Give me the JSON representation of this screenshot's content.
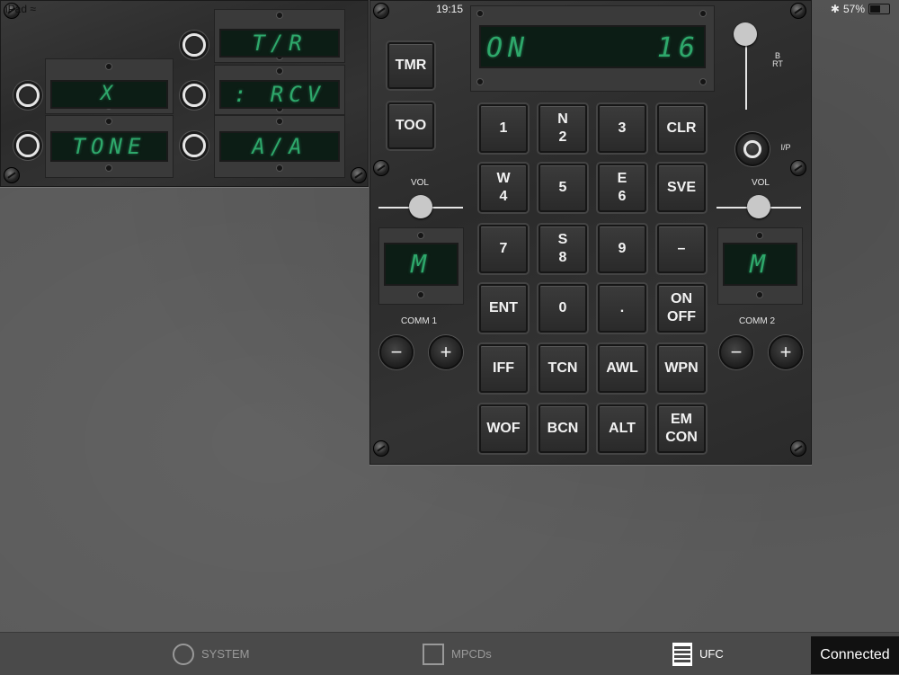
{
  "status_bar": {
    "device": "iPad",
    "time": "19:15",
    "battery_percent": "57%",
    "battery_level": 0.57
  },
  "left_panel": {
    "lcds": {
      "tr": "T/R",
      "x": "X",
      "rcv": ": RCV",
      "tone": "TONE",
      "aa": "A/A"
    }
  },
  "ufc": {
    "scratchpad_left": "ON",
    "scratchpad_right": "16",
    "tmr": "TMR",
    "too": "TOO",
    "brt": "BRT",
    "ip": "I/P",
    "vol_left": "VOL",
    "vol_right": "VOL",
    "vol_left_level": 0.5,
    "vol_right_level": 0.5,
    "brt_level": 0.85,
    "comm1_label": "COMM 1",
    "comm2_label": "COMM 2",
    "comm1_channel": "M",
    "comm2_channel": "M",
    "minus": "−",
    "plus": "+",
    "keys": {
      "k1": {
        "top": "",
        "bot": "1"
      },
      "k2": {
        "top": "N",
        "bot": "2"
      },
      "k3": {
        "top": "",
        "bot": "3"
      },
      "clr": {
        "top": "",
        "bot": "CLR"
      },
      "k4": {
        "top": "W",
        "bot": "4"
      },
      "k5": {
        "top": "",
        "bot": "5"
      },
      "k6": {
        "top": "E",
        "bot": "6"
      },
      "sve": {
        "top": "",
        "bot": "SVE"
      },
      "k7": {
        "top": "",
        "bot": "7"
      },
      "k8": {
        "top": "S",
        "bot": "8"
      },
      "k9": {
        "top": "",
        "bot": "9"
      },
      "dash": {
        "top": "",
        "bot": "–"
      },
      "ent": {
        "top": "",
        "bot": "ENT"
      },
      "k0": {
        "top": "",
        "bot": "0"
      },
      "dot": {
        "top": "",
        "bot": "."
      },
      "onoff": {
        "top": "ON",
        "bot": "OFF"
      },
      "iff": {
        "top": "",
        "bot": "IFF"
      },
      "tcn": {
        "top": "",
        "bot": "TCN"
      },
      "awl": {
        "top": "",
        "bot": "AWL"
      },
      "wpn": {
        "top": "",
        "bot": "WPN"
      },
      "wof": {
        "top": "",
        "bot": "WOF"
      },
      "bcn": {
        "top": "",
        "bot": "BCN"
      },
      "alt": {
        "top": "",
        "bot": "ALT"
      },
      "emcon": {
        "top": "EM",
        "bot": "CON"
      }
    }
  },
  "tab_bar": {
    "system": "SYSTEM",
    "mpcds": "MPCDs",
    "ufc": "UFC",
    "active": "UFC"
  },
  "connection_status": "Connected",
  "colors": {
    "lcd_text": "#2ea86b",
    "background": "#5b5b5b"
  }
}
